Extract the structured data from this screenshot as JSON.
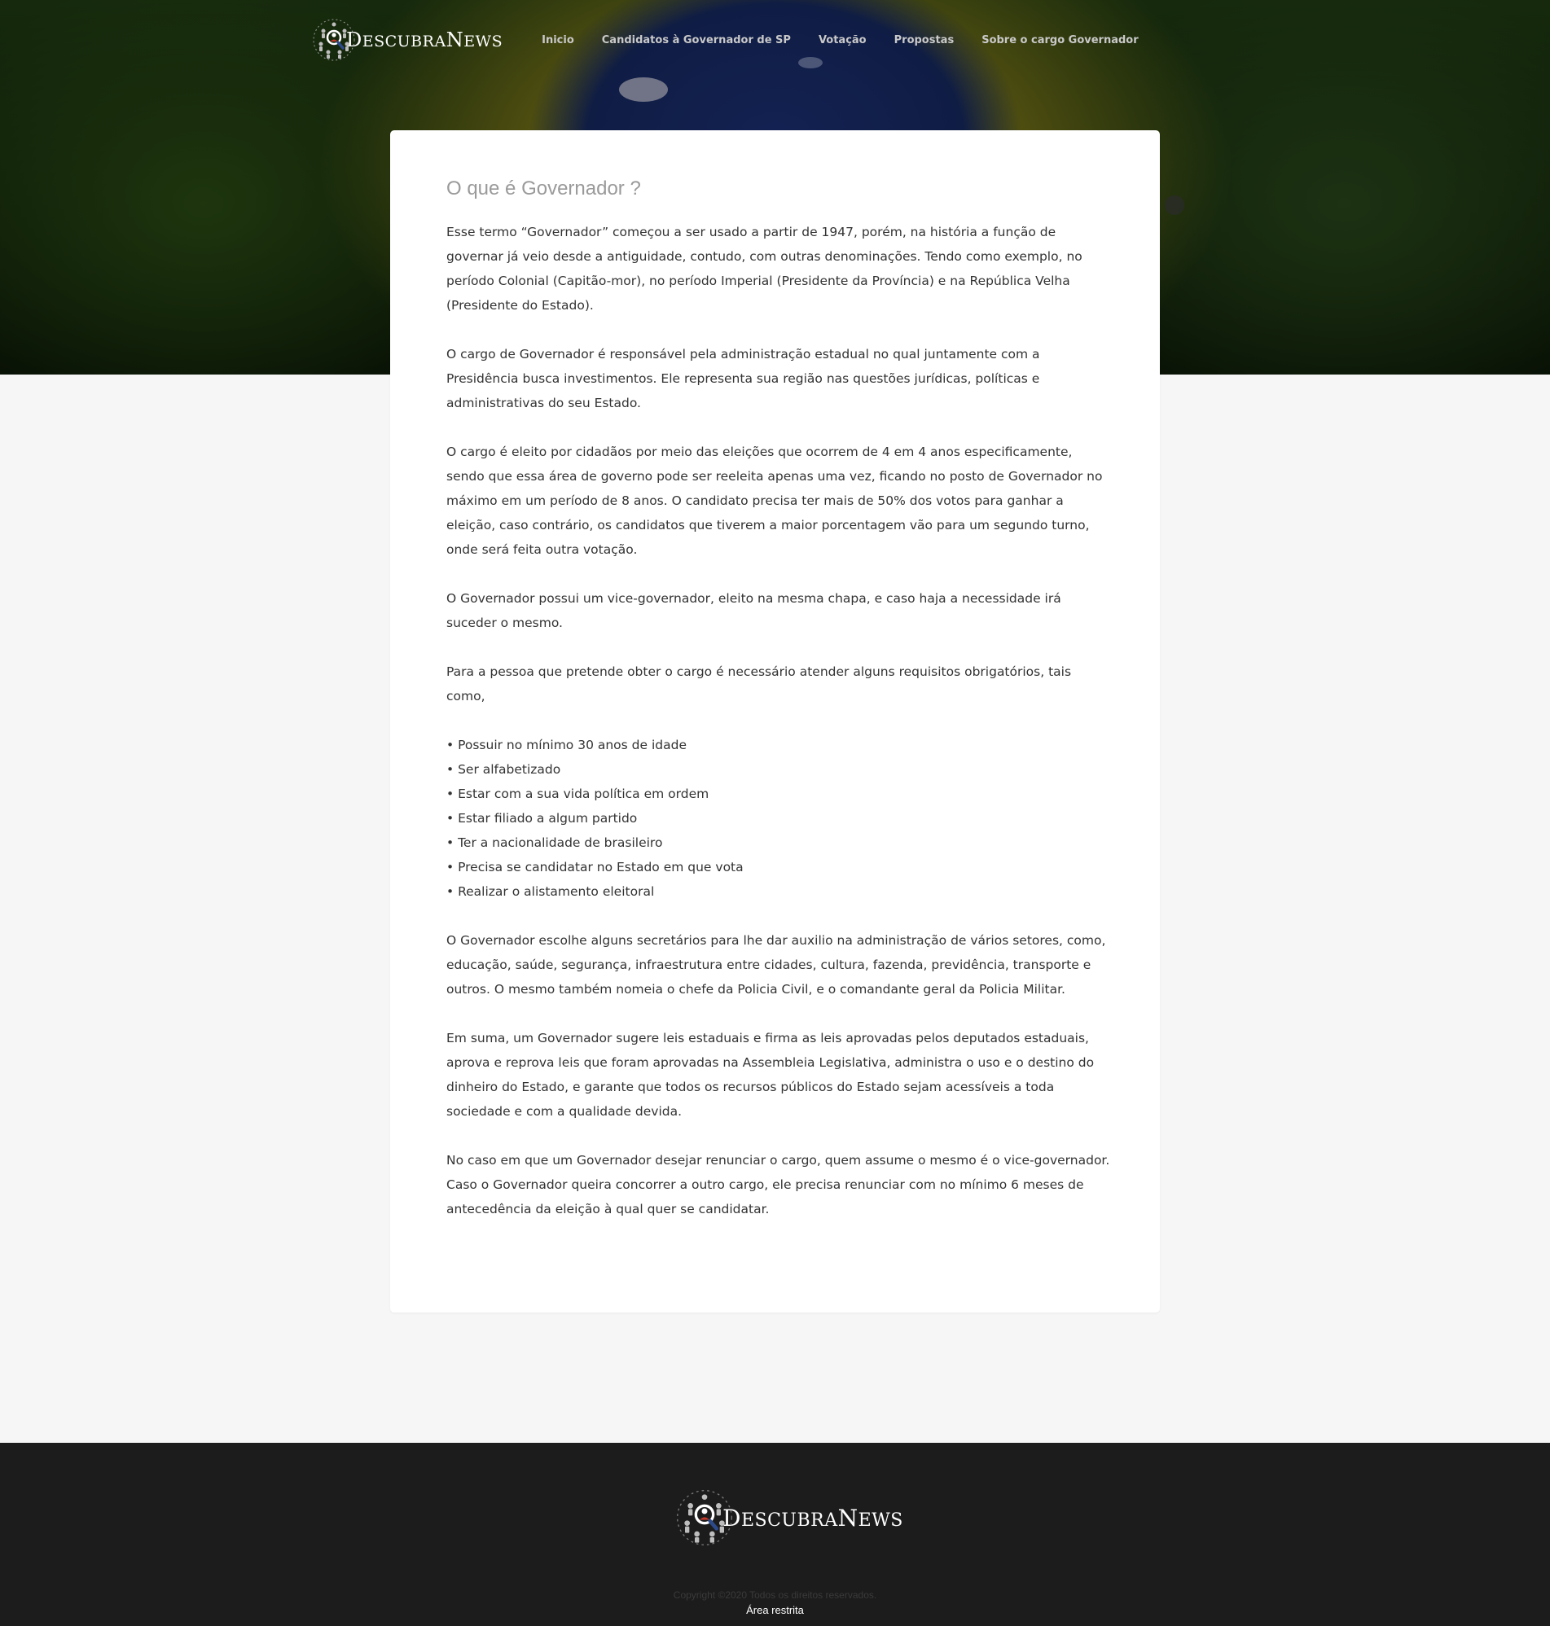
{
  "brand": {
    "logo_first": "D",
    "logo_rest1": "ESCUBRA",
    "logo_mid": "N",
    "logo_rest2": "EWS"
  },
  "nav": {
    "items": [
      "Inicio",
      "Candidatos à Governador de SP",
      "Votação",
      "Propostas",
      "Sobre o cargo Governador"
    ]
  },
  "article": {
    "title": "O que é Governador ?",
    "paragraphs": [
      "Esse termo “Governador” começou a ser usado a partir de 1947, porém, na história a função de governar já veio desde a antiguidade, contudo, com outras denominações. Tendo como exemplo, no período Colonial (Capitão-mor), no período Imperial (Presidente da Província) e na República Velha (Presidente do Estado).",
      "O cargo de Governador é responsável pela administração estadual no qual juntamente com a Presidência busca investimentos. Ele representa sua região nas questões jurídicas, políticas e administrativas do seu Estado.",
      "O cargo é eleito por cidadãos por meio das eleições que ocorrem de 4 em 4 anos especificamente, sendo que essa área de governo pode ser reeleita apenas uma vez, ficando no posto de Governador no máximo em um período de 8 anos. O candidato precisa ter mais de 50% dos votos para ganhar a eleição, caso contrário, os candidatos que tiverem a maior porcentagem vão para um segundo turno, onde será feita outra votação.",
      "O Governador possui um vice-governador, eleito na mesma chapa, e caso haja a necessidade irá suceder o mesmo.",
      "Para a pessoa que pretende obter o cargo é necessário atender alguns requisitos obrigatórios, tais como,"
    ],
    "requirements": [
      "• Possuir no mínimo 30 anos de idade",
      "• Ser alfabetizado",
      "• Estar com a sua vida política em ordem",
      "• Estar filiado a algum partido",
      "• Ter a nacionalidade de brasileiro",
      "• Precisa se candidatar no Estado em que vota",
      "• Realizar o alistamento eleitoral"
    ],
    "paragraphs_after": [
      "O Governador escolhe alguns secretários para lhe dar auxilio na administração de vários setores, como, educação, saúde, segurança, infraestrutura entre cidades, cultura, fazenda, previdência, transporte e outros. O mesmo também nomeia o chefe da Policia Civil, e o comandante geral da Policia Militar.",
      "Em suma, um Governador sugere leis estaduais e firma as leis aprovadas pelos deputados estaduais, aprova e reprova leis que foram aprovadas na Assembleia Legislativa, administra o uso e o destino do dinheiro do Estado, e garante que todos os recursos públicos do Estado sejam acessíveis a toda sociedade e com a qualidade devida."
    ],
    "closing_line1": "No caso em que um Governador desejar renunciar o cargo, quem assume o mesmo é o vice-governador.",
    "closing_line2": "Caso o Governador queira concorrer a outro cargo, ele precisa renunciar com no mínimo 6 meses de antecedência da eleição à qual quer se candidatar."
  },
  "footer": {
    "copyright": "Copyright ©2020 Todos os direitos reservados.",
    "restricted_link": "Área restrita"
  },
  "colors": {
    "page_bg": "#f6f6f6",
    "card_bg": "#ffffff",
    "footer_bg": "#1c1c1c",
    "title_gray": "#9a9a9a",
    "body_text": "#333333",
    "nav_text": "#c9c9c9"
  },
  "icons": {
    "logo": "people-magnifier-logo-icon"
  }
}
